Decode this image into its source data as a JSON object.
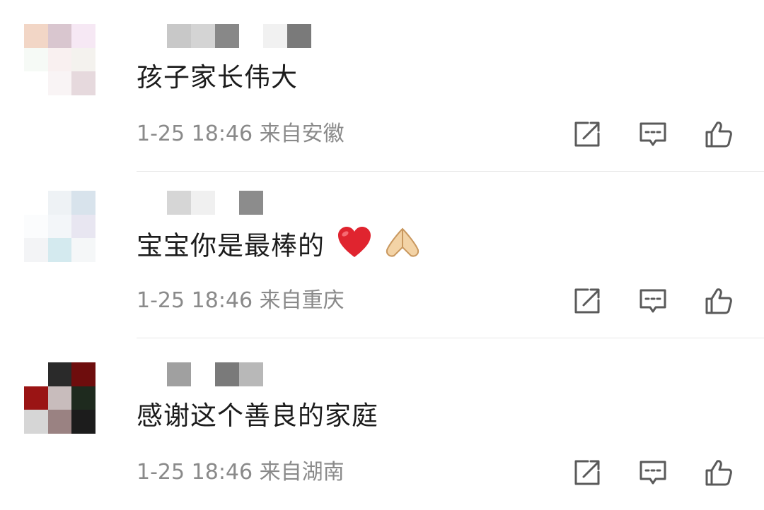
{
  "comments": [
    {
      "text": "孩子家长伟大",
      "date": "1-25",
      "time": "18:46",
      "location": "来自安徽",
      "avatar_colors": [
        "#f2d6c6",
        "#d9c6cf",
        "#f6e8f4",
        "#f6faf6",
        "#f9f0f0",
        "#f4f2ee",
        "#ffffff",
        "#f9f4f5",
        "#e6d9dd"
      ],
      "name_blocks": [
        "#c8c8c8",
        "#d4d4d4",
        "#888888",
        "#ffffff",
        "#f1f1f1",
        "#7a7a7a"
      ]
    },
    {
      "text": "宝宝你是最棒的",
      "date": "1-25",
      "time": "18:46",
      "location": "来自重庆",
      "avatar_colors": [
        "#ffffff",
        "#eef2f5",
        "#d8e3ec",
        "#fbfcfd",
        "#f3f6f9",
        "#e8e6f1",
        "#f3f4f6",
        "#d4eaef",
        "#f5f7f8"
      ],
      "name_blocks": [
        "#d6d6d6",
        "#f0f0f0",
        "#ffffff",
        "#8c8c8c"
      ],
      "emojis": [
        "heart-emoji",
        "pinched-hand-emoji"
      ]
    },
    {
      "text": "感谢这个善良的家庭",
      "date": "1-25",
      "time": "18:46",
      "location": "来自湖南",
      "avatar_colors": [
        "#ffffff",
        "#2a2a2a",
        "#6e0d0d",
        "#9a1414",
        "#c8bcbc",
        "#1e2a1e",
        "#d6d6d6",
        "#9a8282",
        "#1c1c1c"
      ],
      "name_blocks": [
        "#a0a0a0",
        "#ffffff",
        "#7a7a7a",
        "#b8b8b8"
      ]
    }
  ],
  "icons": {
    "share": "share-icon",
    "reply": "comment-icon",
    "like": "thumbs-up-icon"
  },
  "colors": {
    "text": "#1c1c1c",
    "meta": "#8a8a8a",
    "icon": "#5a5a5a",
    "divider": "#e6e6e6",
    "heart": "#e0242f"
  }
}
